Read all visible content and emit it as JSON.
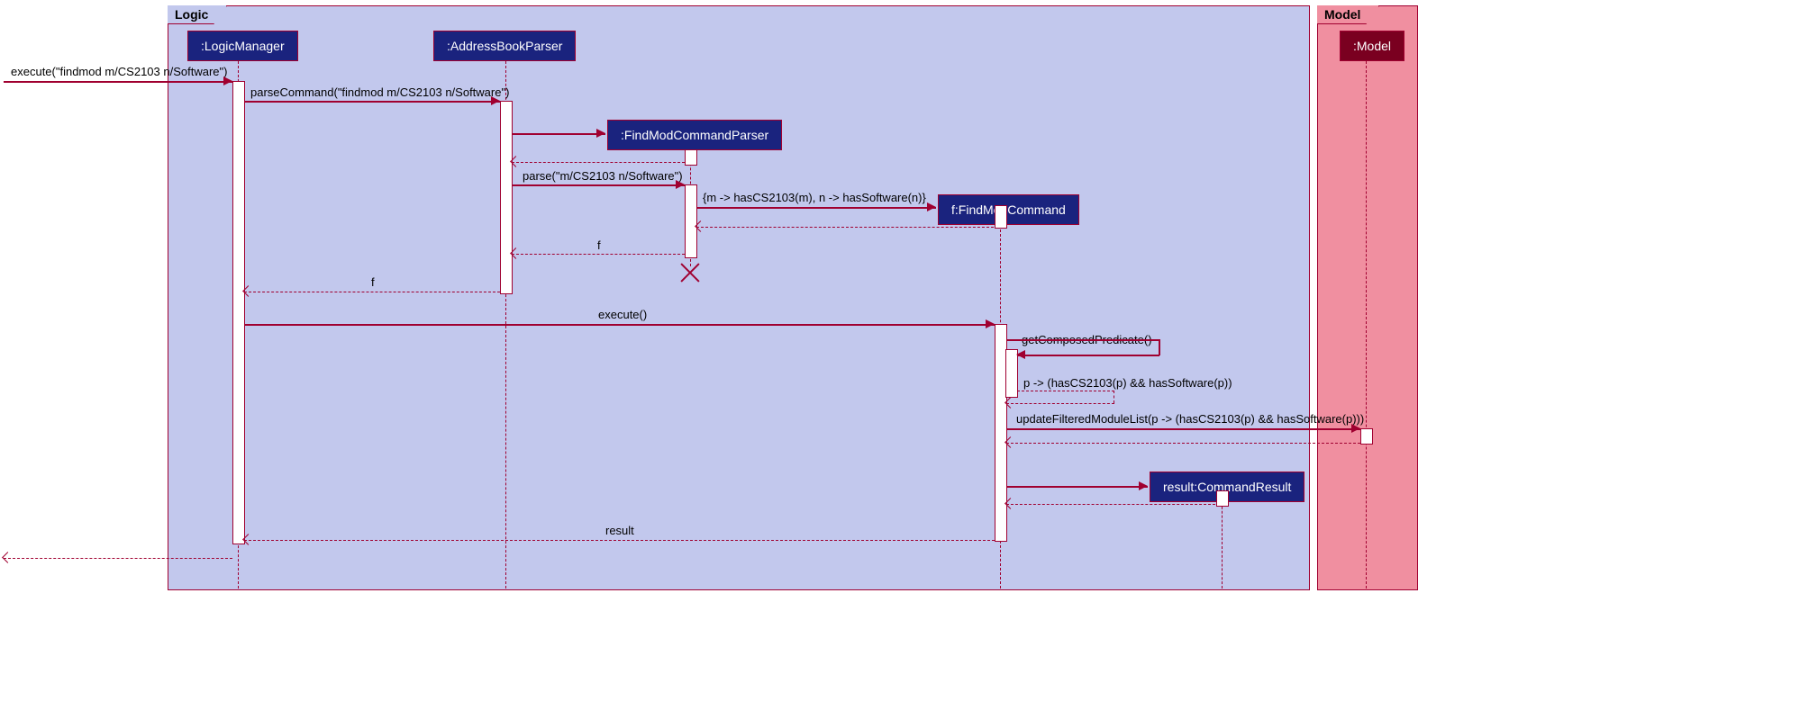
{
  "frames": {
    "logic": {
      "label": "Logic"
    },
    "model": {
      "label": "Model"
    }
  },
  "participants": {
    "logicManager": ":LogicManager",
    "addressBookParser": ":AddressBookParser",
    "findModCommandParser": ":FindModCommandParser",
    "findModCommand": "f:FindModCommand",
    "commandResult": "result:CommandResult",
    "model": ":Model"
  },
  "messages": {
    "execute1": "execute(\"findmod m/CS2103 n/Software\")",
    "parseCommand": "parseCommand(\"findmod m/CS2103 n/Software\")",
    "parse": "parse(\"m/CS2103 n/Software\")",
    "predicates": "{m -> hasCS2103(m), n -> hasSoftware(n)}",
    "f1": "f",
    "f2": "f",
    "execute2": "execute()",
    "getComposed": "getComposedPredicate()",
    "composedResult": "p -> (hasCS2103(p) && hasSoftware(p))",
    "updateFiltered": "updateFilteredModuleList(p -> (hasCS2103(p) && hasSoftware(p)))",
    "result": "result"
  }
}
